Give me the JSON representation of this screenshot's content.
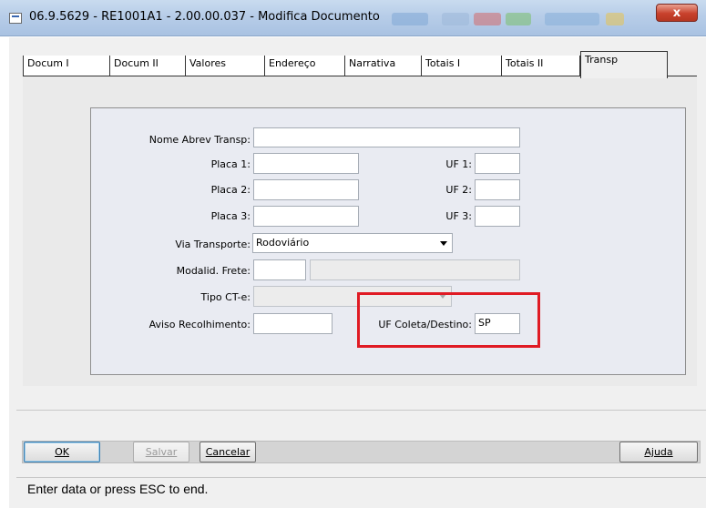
{
  "window": {
    "title": "06.9.5629 - RE1001A1 - 2.00.00.037 - Modifica Documento",
    "close_label": "x"
  },
  "tabs": [
    {
      "label": "Docum I"
    },
    {
      "label": "Docum II"
    },
    {
      "label": "Valores"
    },
    {
      "label": "Endereço"
    },
    {
      "label": "Narrativa"
    },
    {
      "label": "Totais I"
    },
    {
      "label": "Totais II"
    },
    {
      "label": "Transp",
      "active": true
    }
  ],
  "form": {
    "nome_abrev_transp": {
      "label": "Nome Abrev Transp:",
      "value": ""
    },
    "placa_1": {
      "label": "Placa 1:",
      "value": ""
    },
    "placa_2": {
      "label": "Placa 2:",
      "value": ""
    },
    "placa_3": {
      "label": "Placa 3:",
      "value": ""
    },
    "uf_1": {
      "label": "UF 1:",
      "value": ""
    },
    "uf_2": {
      "label": "UF 2:",
      "value": ""
    },
    "uf_3": {
      "label": "UF 3:",
      "value": ""
    },
    "via_transporte": {
      "label": "Via Transporte:",
      "value": "Rodoviário"
    },
    "modalid_frete": {
      "label": "Modalid. Frete:",
      "value": "",
      "description": ""
    },
    "tipo_cte": {
      "label": "Tipo CT-e:",
      "value": ""
    },
    "aviso_recolhimento": {
      "label": "Aviso Recolhimento:",
      "value": ""
    },
    "uf_coleta_destino": {
      "label": "UF Coleta/Destino:",
      "value": "SP"
    }
  },
  "buttons": {
    "ok": "OK",
    "salvar": "Salvar",
    "cancelar": "Cancelar",
    "ajuda": "Ajuda"
  },
  "status": {
    "message": "Enter data or press ESC to end."
  },
  "colors": {
    "highlight": "#e01b24",
    "titlebar": "#b7cde8"
  }
}
